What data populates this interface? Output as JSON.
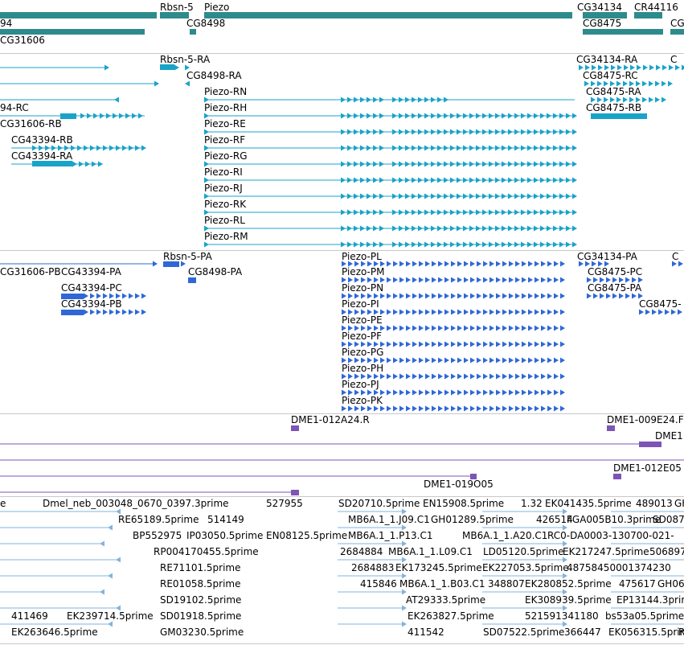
{
  "colors": {
    "gene": "#2e8b8b",
    "transcript": "#1aa3c8",
    "protein": "#2f68d6",
    "probe": "#7d55b5",
    "est": "#82b4dd",
    "separator": "#c8c8c8"
  },
  "tracks": {
    "genes": {
      "labels": [
        "94",
        "Rbsn-5",
        "Piezo",
        "CG34134",
        "CR44116",
        "CG31606",
        "CG8498",
        "CG8475",
        "CG"
      ]
    },
    "transcripts": {
      "labels": [
        "Rbsn-5-RA",
        "CG34134-RA",
        "CG8498-RA",
        "CG8475-RC",
        "94-RC",
        "Piezo-RN",
        "CG8475-RA",
        "Piezo-RH",
        "CG8475-RB",
        "CG31606-RB",
        "Piezo-RE",
        "Piezo-RF",
        "CG43394-RB",
        "Piezo-RG",
        "CG43394-RA",
        "Piezo-RI",
        "Piezo-RJ",
        "Piezo-RK",
        "Piezo-RL",
        "Piezo-RM",
        "C"
      ]
    },
    "proteins": {
      "labels": [
        "Rbsn-5-PA",
        "Piezo-PL",
        "CG34134-PA",
        "CG31606-PB",
        "CG43394-PA",
        "CG8498-PA",
        "Piezo-PM",
        "CG8475-PC",
        "CG43394-PC",
        "Piezo-PN",
        "CG8475-PA",
        "CG43394-PB",
        "Piezo-PI",
        "CG8475-",
        "Piezo-PE",
        "Piezo-PF",
        "Piezo-PG",
        "Piezo-PH",
        "Piezo-PJ",
        "Piezo-PK",
        "C"
      ]
    },
    "probes": {
      "labels": [
        "DME1-012A24.R",
        "DME1-009E24.F",
        "DME1",
        "DME1-012E05",
        "DME1-019O05"
      ]
    },
    "ests": {
      "labels": [
        "e",
        "Dmel_neb_003048_0670_0397.3prime",
        "527955",
        "SD20710.5prime",
        "EN15908.5prime",
        "1.32",
        "EK041435.5prime",
        "489013",
        "GH",
        "RE65189.5prime",
        "514149",
        "MB6A.1_1.J09.C1",
        "GH01289.5prime",
        "426514",
        "FGA005B10.3prime",
        "SD087",
        "BP552975",
        "IP03050.5prime",
        "EN08125.5prime",
        "MB6A.1_1.P13.C1",
        "MB6A.1_1.A20.C1",
        "RC0-DA0003-130700-021-",
        "RP004170455.5prime",
        "2684884",
        "MB6A.1_1.L09.C1",
        "LD05120.5prime",
        "EK217247.5prime",
        "506897",
        "RE71101.5prime",
        "2684883",
        "EK173245.5prime",
        "EK227053.5prime",
        "48758450001374230",
        "RE01058.5prime",
        "415846",
        "MB6A.1_1.B03.C1",
        "348807",
        "EK280852.5prime",
        "475617",
        "GH06",
        "SD19102.5prime",
        "AT29333.5prime",
        "EK308939.5prime",
        "EP13144.3prime",
        "411469",
        "EK239714.5prime",
        "SD01918.5prime",
        "EK263827.5prime",
        "521591341180",
        "bs53a05.5prime",
        "EK263646.5prime",
        "GM03230.5prime",
        "411542",
        "SD07522.5prime",
        "366447",
        "EK056315.5prime",
        "R"
      ]
    }
  }
}
